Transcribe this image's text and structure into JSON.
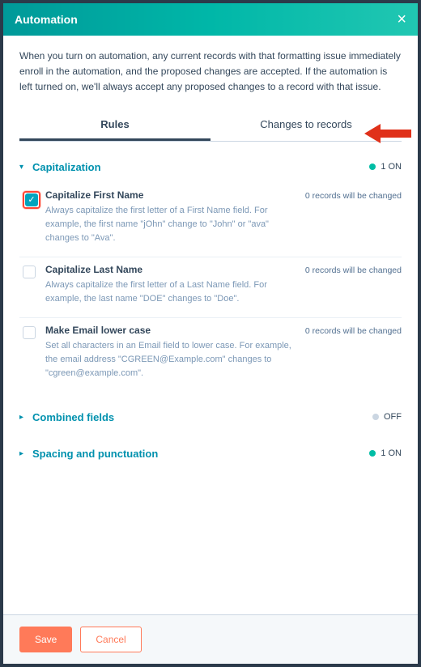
{
  "header": {
    "title": "Automation"
  },
  "intro": "When you turn on automation, any current records with that formatting issue immediately enroll in the automation, and the proposed changes are accepted. If the automation is left turned on, we'll always accept any proposed changes to a record with that issue.",
  "tabs": {
    "rules": "Rules",
    "changes": "Changes to records"
  },
  "status_labels": {
    "on": "1 ON",
    "off": "OFF"
  },
  "records_label": "0 records will be changed",
  "sections": {
    "capitalization": {
      "title": "Capitalization",
      "status": "on",
      "rules": [
        {
          "title": "Capitalize First Name",
          "desc": "Always capitalize the first letter of a First Name field. For example, the first name \"jOhn\" change to \"John\" or \"ava\" changes to \"Ava\".",
          "checked": true
        },
        {
          "title": "Capitalize Last Name",
          "desc": "Always capitalize the first letter of a Last Name field. For example, the last name \"DOE\" changes to \"Doe\".",
          "checked": false
        },
        {
          "title": "Make Email lower case",
          "desc": "Set all characters in an Email field to lower case. For example, the email address \"CGREEN@Example.com\" changes to \"cgreen@example.com\".",
          "checked": false
        }
      ]
    },
    "combined": {
      "title": "Combined fields",
      "status": "off"
    },
    "spacing": {
      "title": "Spacing and punctuation",
      "status": "on"
    }
  },
  "footer": {
    "save": "Save",
    "cancel": "Cancel"
  }
}
